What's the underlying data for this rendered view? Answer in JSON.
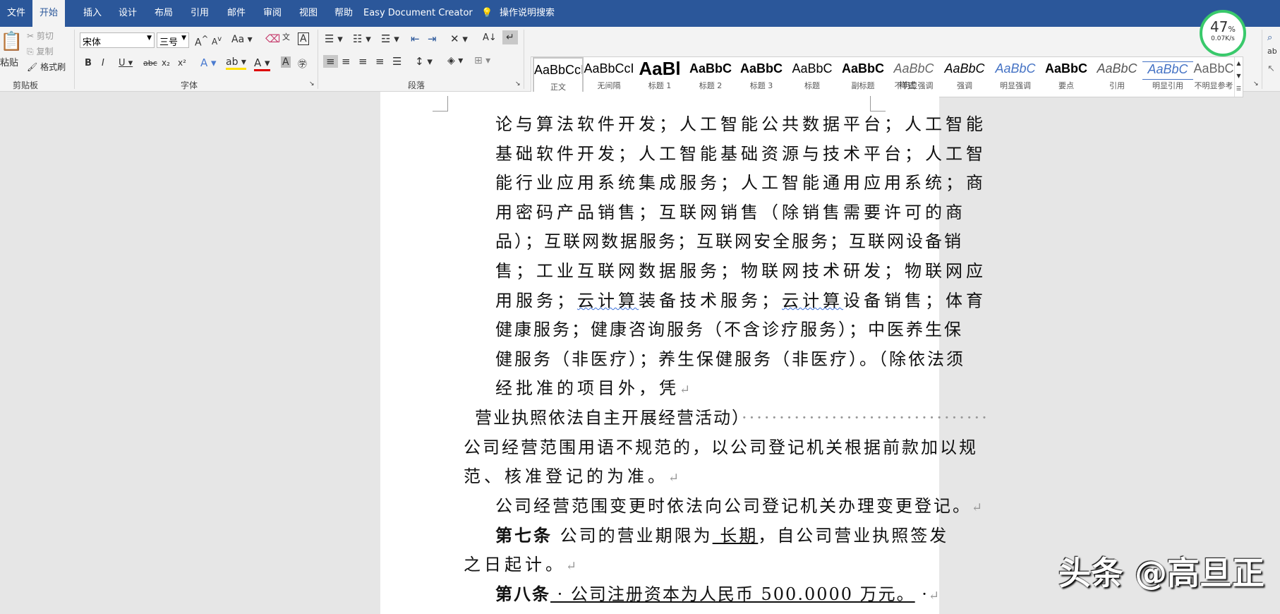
{
  "tabs": [
    "文件",
    "开始",
    "插入",
    "设计",
    "布局",
    "引用",
    "邮件",
    "审阅",
    "视图",
    "帮助",
    "Easy Document Creator"
  ],
  "tell_me": "操作说明搜索",
  "clipboard": {
    "paste": "粘贴",
    "cut": "剪切",
    "copy": "复制",
    "format_painter": "格式刷",
    "label": "剪贴板"
  },
  "font": {
    "name": "宋体",
    "size": "三号",
    "label": "字体"
  },
  "paragraph": {
    "label": "段落"
  },
  "styles": {
    "label": "样式",
    "items": [
      {
        "preview": "AaBbCcI",
        "name": "正文"
      },
      {
        "preview": "AaBbCcI",
        "name": "无间隔"
      },
      {
        "preview": "AaBl",
        "name": "标题 1"
      },
      {
        "preview": "AaBbC",
        "name": "标题 2"
      },
      {
        "preview": "AaBbC",
        "name": "标题 3"
      },
      {
        "preview": "AaBbC",
        "name": "标题"
      },
      {
        "preview": "AaBbC",
        "name": "副标题"
      },
      {
        "preview": "AaBbC",
        "name": "不明显强调"
      },
      {
        "preview": "AaBbC",
        "name": "强调"
      },
      {
        "preview": "AaBbC",
        "name": "明显强调"
      },
      {
        "preview": "AaBbC",
        "name": "要点"
      },
      {
        "preview": "AaBbC",
        "name": "引用"
      },
      {
        "preview": "AaBbC",
        "name": "明显引用"
      },
      {
        "preview": "AaBbC",
        "name": "不明显参考"
      }
    ]
  },
  "gauge": {
    "percent": "47",
    "unit": "%",
    "speed": "0.07K/s"
  },
  "doc": {
    "l1": "论与算法软件开发；人工智能公共数据平台；人工智能",
    "l2": "基础软件开发；人工智能基础资源与技术平台；人工智",
    "l3": "能行业应用系统集成服务；人工智能通用应用系统；商",
    "l4": "用密码产品销售；互联网销售（除销售需要许可的商",
    "l5": "品）；互联网数据服务；互联网安全服务；互联网设备销",
    "l6": "售；工业互联网数据服务；物联网技术研发；物联网应",
    "l7a": "用服务；",
    "l7b": "云计算",
    "l7c": "装备技术服务；",
    "l7d": "云计算",
    "l7e": "设备销售；体育",
    "l8": "健康服务；健康咨询服务（不含诊疗服务）；中医养生保",
    "l9": "健服务（非医疗）；养生保健服务（非医疗）。（除依法须",
    "l10": "经批准的项目外，凭",
    "l11": "营业执照依法自主开展经营活动）",
    "l12": "公司经营范围用语不规范的，以公司登记机关根据前款加以规",
    "l13": "范、核准登记的为准。",
    "l14": "公司经营范围变更时依法向公司登记机关办理变更登记。",
    "l15a": "第七条",
    "l15b": " 公司的营业期限为",
    "l15c": " 长期",
    "l15d": "，自公司营业执照签发",
    "l16": "之日起计。",
    "l17a": "第八条",
    "l17b": " · 公司注册资本为人民币 500.0000 万元。",
    "l17c": " ·",
    "para_mark": "↵"
  },
  "watermark": "头条 @高旦正"
}
